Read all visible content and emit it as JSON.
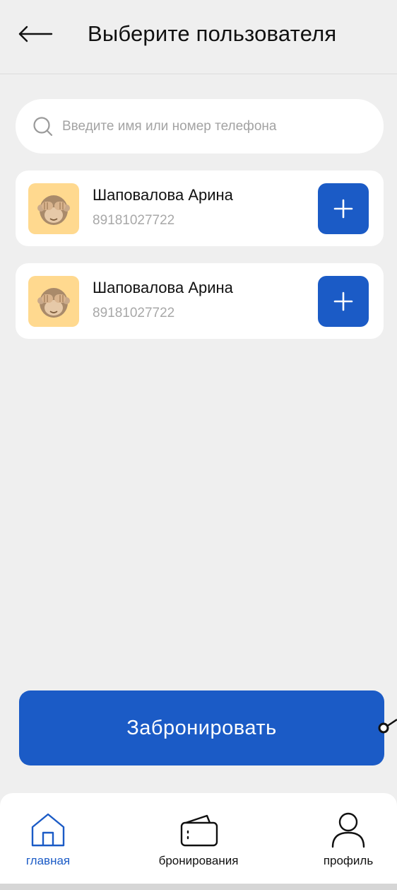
{
  "header": {
    "title": "Выберите пользователя",
    "back_icon": "arrow-left-icon"
  },
  "search": {
    "placeholder": "Введите имя или номер телефона",
    "value": "",
    "icon": "search-icon"
  },
  "users": [
    {
      "name": "Шаповалова Арина",
      "phone": "89181027722",
      "avatar": "see-no-evil-monkey-emoji",
      "action_icon": "plus-icon"
    },
    {
      "name": "Шаповалова Арина",
      "phone": "89181027722",
      "avatar": "see-no-evil-monkey-emoji",
      "action_icon": "plus-icon"
    }
  ],
  "book_button": {
    "label": "Забронировать"
  },
  "bottom_nav": {
    "items": [
      {
        "label": "главная",
        "icon": "home-icon",
        "active": true
      },
      {
        "label": "бронирования",
        "icon": "wallet-icon",
        "active": false
      },
      {
        "label": "профиль",
        "icon": "user-icon",
        "active": false
      }
    ]
  },
  "colors": {
    "accent": "#1b5bc6",
    "background": "#efefef",
    "card": "#ffffff",
    "avatar_bg": "#ffd98f",
    "muted_text": "#a8a8a8"
  }
}
